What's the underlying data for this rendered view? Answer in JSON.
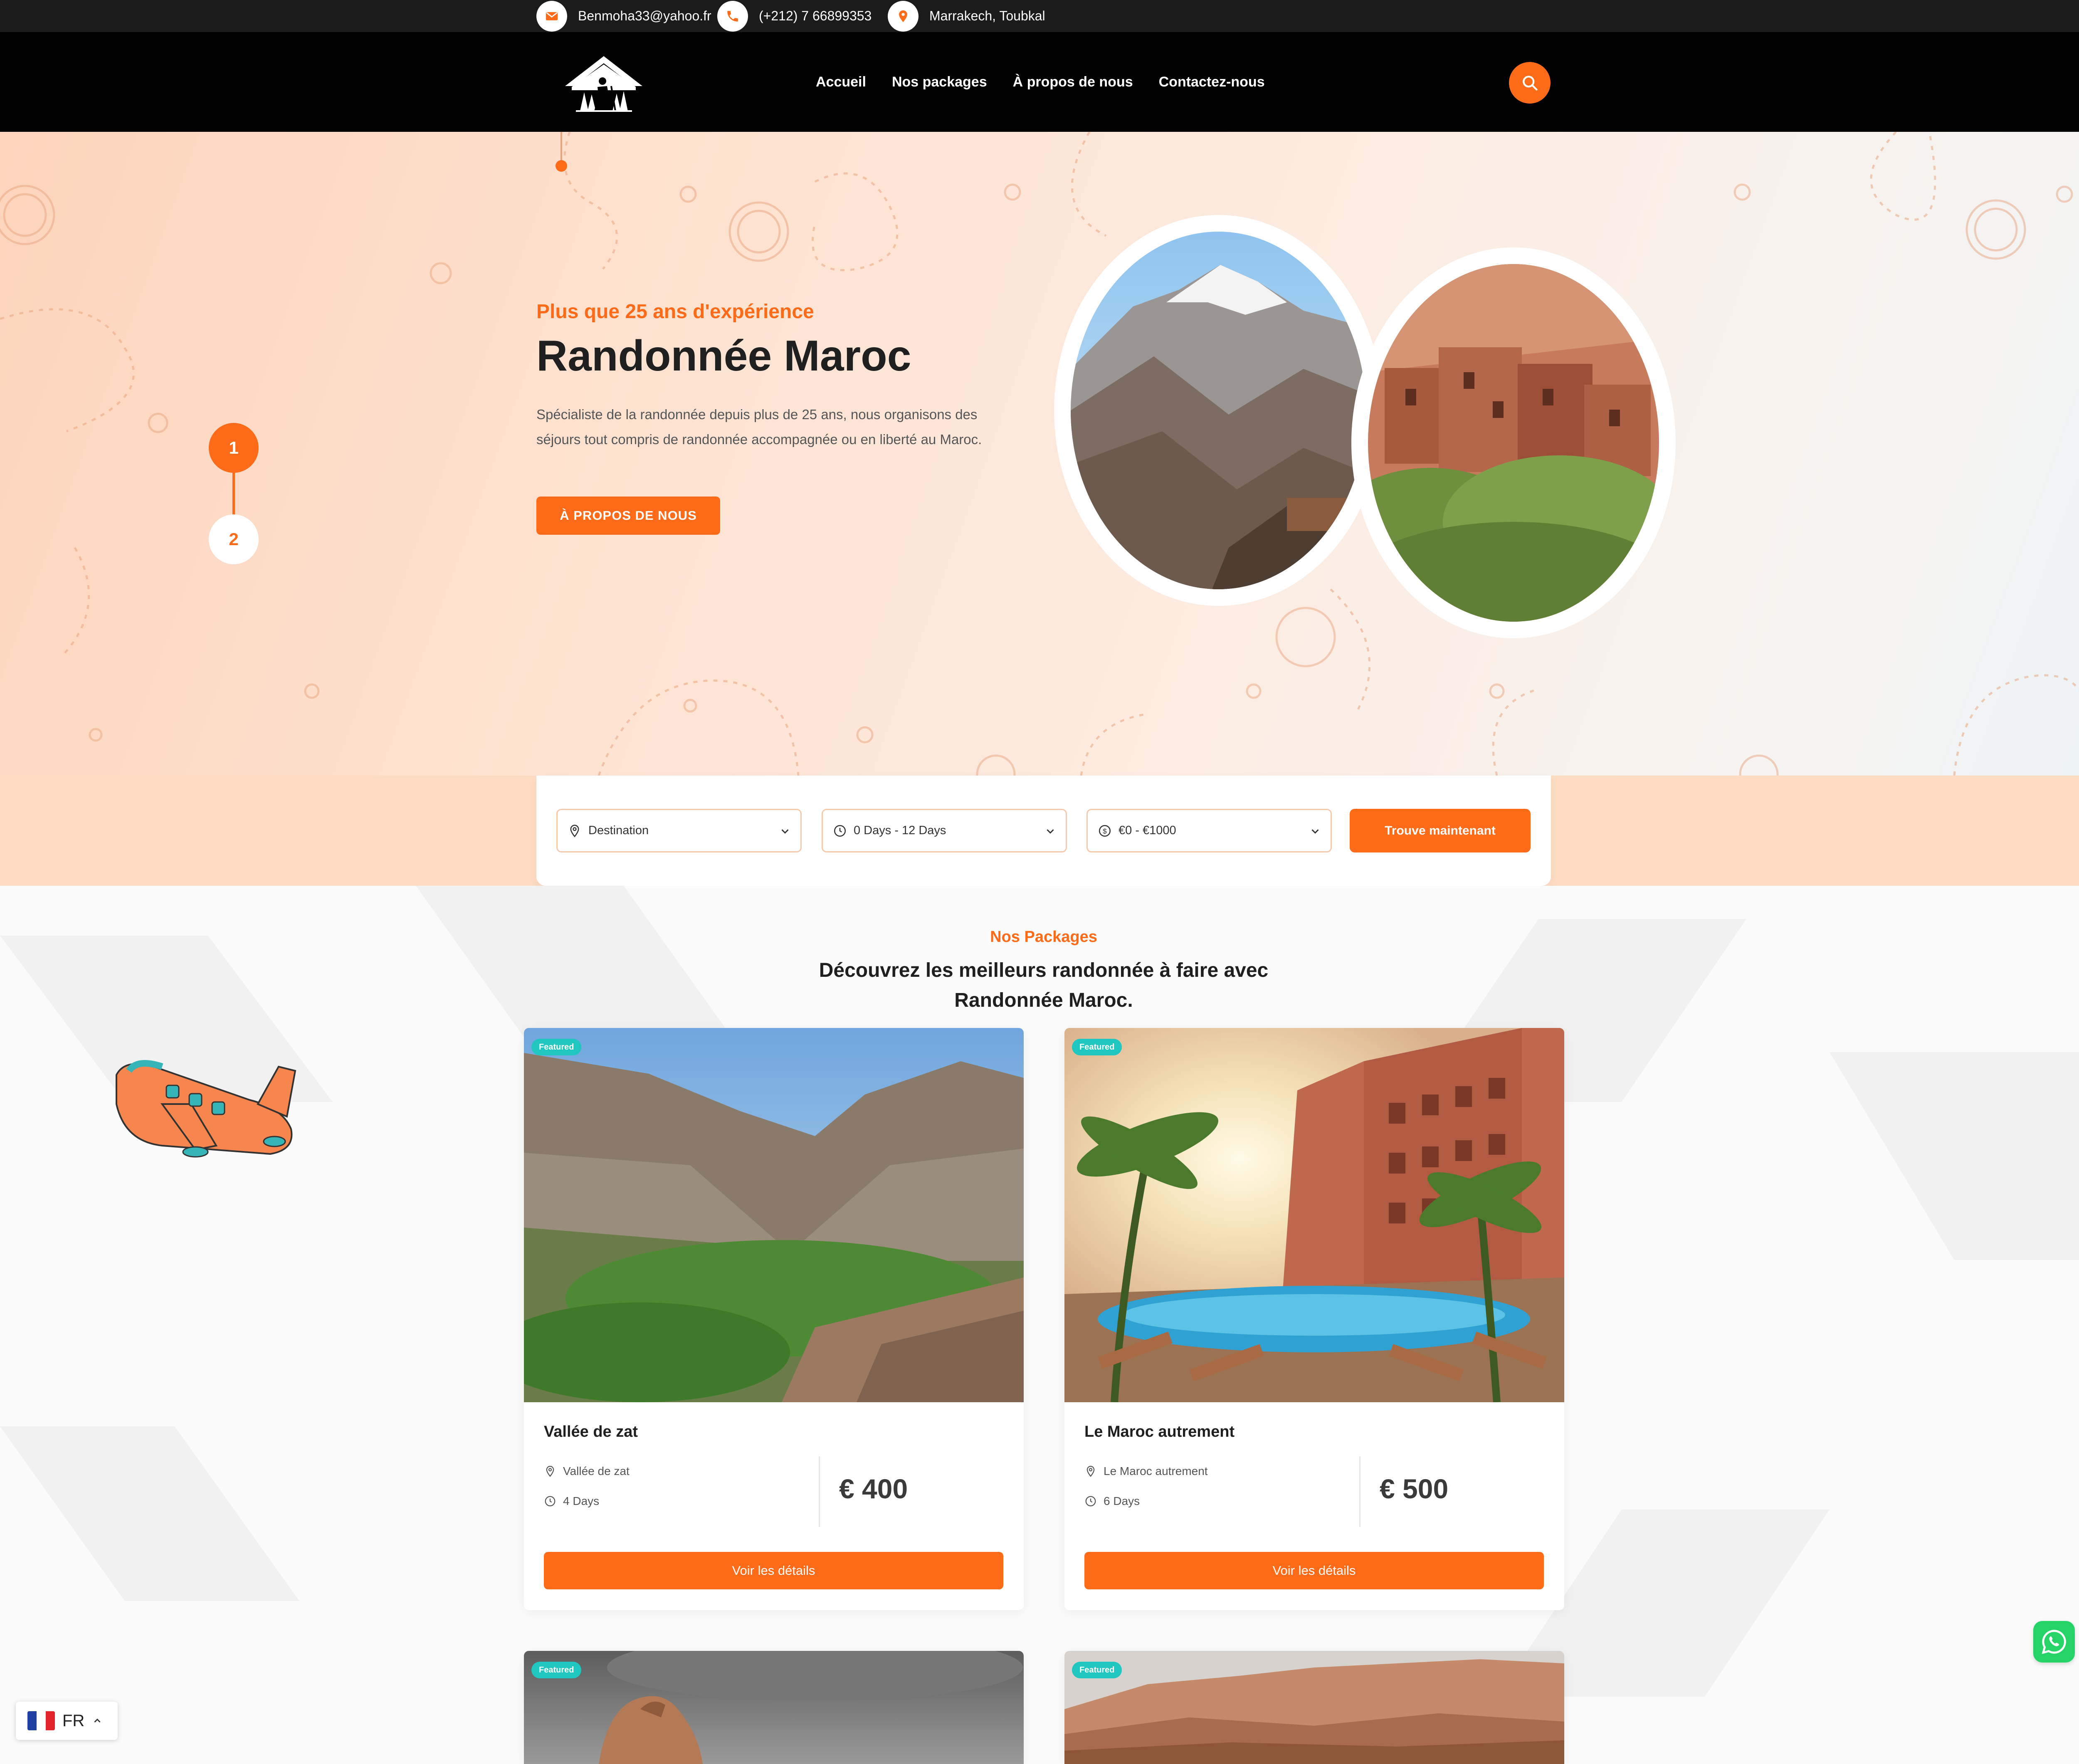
{
  "topbar": {
    "email": "Benmoha33@yahoo.fr",
    "phone": "(+212) 7 66899353",
    "location": "Marrakech, Toubkal"
  },
  "nav": {
    "items": [
      "Accueil",
      "Nos packages",
      "À propos de nous",
      "Contactez-nous"
    ]
  },
  "hero": {
    "subtitle": "Plus que 25 ans d'expérience",
    "title": "Randonnée Maroc",
    "description": "Spécialiste de la randonnée depuis plus de 25 ans, nous organisons des séjours tout compris de randonnée accompagnée ou en liberté au Maroc.",
    "button": "À PROPOS DE NOUS",
    "slides": [
      "1",
      "2"
    ],
    "active_slide": 1
  },
  "search": {
    "destination": "Destination",
    "duration": "0 Days - 12 Days",
    "budget": "€0 - €1000",
    "button": "Trouve maintenant"
  },
  "packages": {
    "subtitle": "Nos Packages",
    "title": "Découvrez les meilleurs randonnée à faire avec Randonnée Maroc.",
    "items": [
      {
        "badge": "Featured",
        "title": "Vallée de zat",
        "location": "Vallée de zat",
        "duration": "4 Days",
        "price": "€ 400",
        "button": "Voir les détails"
      },
      {
        "badge": "Featured",
        "title": "Le Maroc autrement",
        "location": "Le Maroc autrement",
        "duration": "6 Days",
        "price": "€ 500",
        "button": "Voir les détails"
      },
      {
        "badge": "Featured"
      },
      {
        "badge": "Featured"
      }
    ]
  },
  "language": {
    "code": "FR"
  },
  "colors": {
    "accent": "#fd6b18",
    "badge": "#1fc7c0",
    "dark": "#000000",
    "whatsapp": "#25d366"
  },
  "icons": [
    "envelope-icon",
    "phone-icon",
    "map-pin-icon",
    "search-icon",
    "location-icon",
    "clock-icon",
    "dollar-icon",
    "chevron-down-icon",
    "whatsapp-icon",
    "chevron-up-icon"
  ]
}
